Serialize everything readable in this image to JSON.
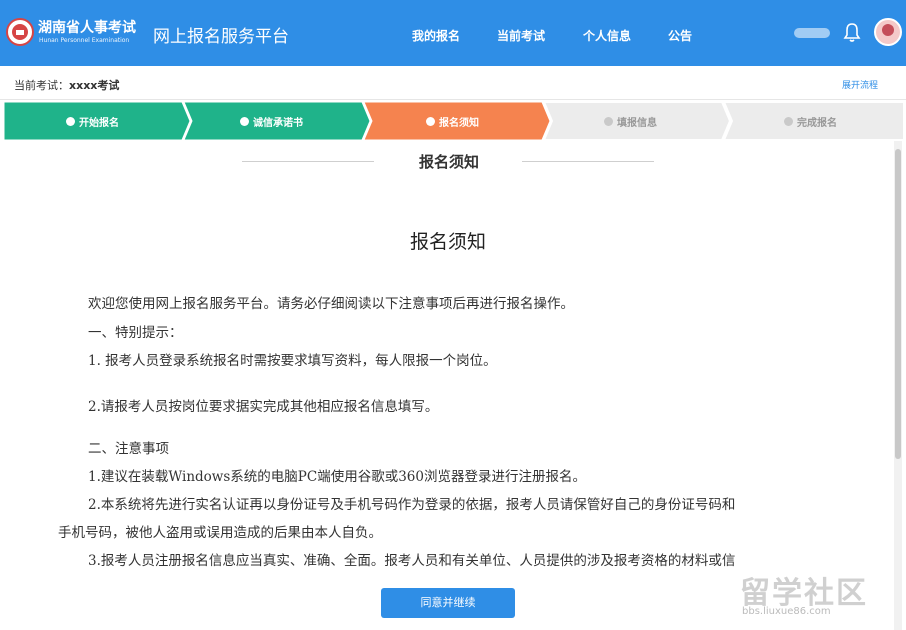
{
  "header": {
    "brand_cn": "湖南省人事考试",
    "brand_en": "Hunan Personnel Examination",
    "platform_title": "网上报名服务平台",
    "nav": [
      "我的报名",
      "当前考试",
      "个人信息",
      "公告"
    ]
  },
  "exam_bar": {
    "label": "当前考试：",
    "exam_name": "xxxx考试",
    "expand_link": "展开流程"
  },
  "steps": [
    {
      "label": "开始报名",
      "state": "done"
    },
    {
      "label": "诚信承诺书",
      "state": "done"
    },
    {
      "label": "报名须知",
      "state": "current"
    },
    {
      "label": "填报信息",
      "state": "todo"
    },
    {
      "label": "完成报名",
      "state": "todo"
    }
  ],
  "colors": {
    "primary": "#2f8ee6",
    "step_done": "#1fb38a",
    "step_current": "#f5834f",
    "step_todo": "#ececec"
  },
  "content": {
    "section_title": "报名须知",
    "doc_title": "报名须知",
    "paragraphs": [
      "欢迎您使用网上报名服务平台。请务必仔细阅读以下注意事项后再进行报名操作。",
      "一、特别提示：",
      "1. 报考人员登录系统报名时需按要求填写资料，每人限报一个岗位。",
      "2.请报考人员按岗位要求据实完成其他相应报名信息填写。",
      "二、注意事项",
      "1.建议在装载Windows系统的电脑PC端使用谷歌或360浏览器登录进行注册报名。",
      "2.本系统将先进行实名认证再以身份证号及手机号码作为登录的依据，报考人员请保管好自己的身份证号码和",
      "手机号码，被他人盗用或误用造成的后果由本人自负。",
      "3.报考人员注册报名信息应当真实、准确、全面。报考人员和有关单位、人员提供的涉及报考资格的材料或信"
    ]
  },
  "agree_button": "同意并继续",
  "watermark": {
    "big": "留学社区",
    "small": "bbs.liuxue86.com"
  }
}
